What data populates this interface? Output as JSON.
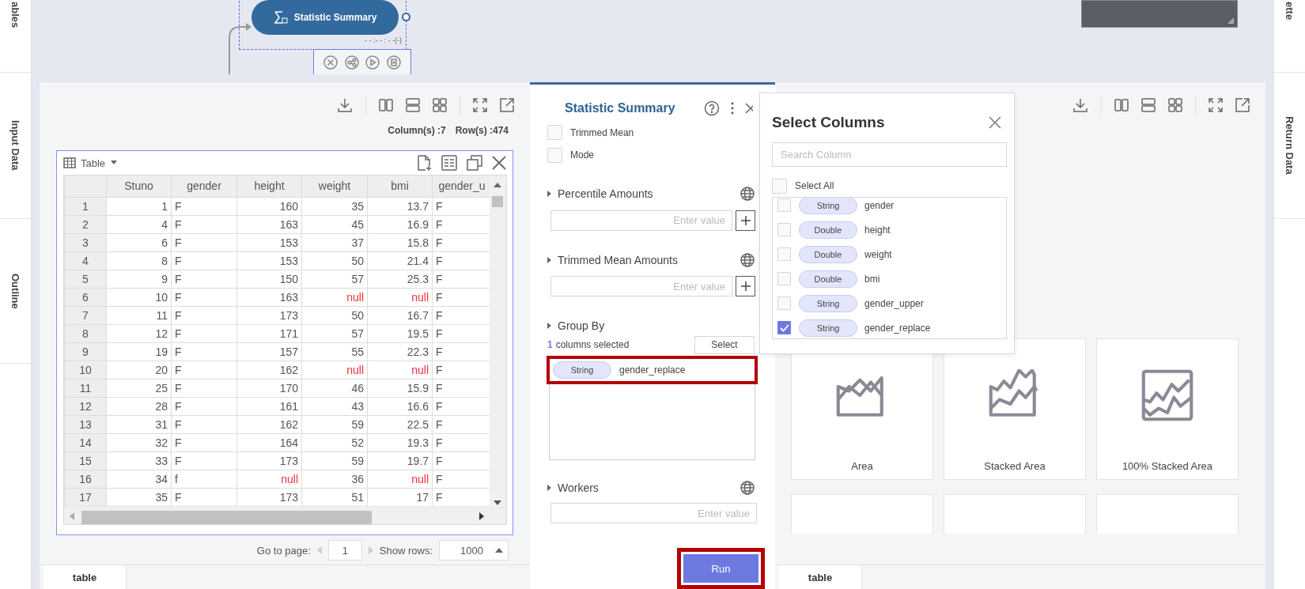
{
  "left_rail": [
    {
      "label": "ables"
    },
    {
      "label": "Input Data"
    },
    {
      "label": "Outline"
    }
  ],
  "right_rail": [
    {
      "label": "ette"
    },
    {
      "label": "Return Data"
    }
  ],
  "canvas": {
    "node": {
      "label": "Statistic Summary",
      "status": "- - :- - : - -(-)"
    }
  },
  "data_panel": {
    "column_count": "Column(s) :7",
    "row_count": "Row(s) :474",
    "table": {
      "view": "Table",
      "columns": [
        "Stuno",
        "gender",
        "height",
        "weight",
        "bmi",
        "gender_u"
      ],
      "rows": [
        {
          "index": "1",
          "cells": [
            "1",
            "F",
            "160",
            "35",
            "13.7",
            "F"
          ]
        },
        {
          "index": "2",
          "cells": [
            "4",
            "F",
            "163",
            "45",
            "16.9",
            "F"
          ]
        },
        {
          "index": "3",
          "cells": [
            "6",
            "F",
            "153",
            "37",
            "15.8",
            "F"
          ]
        },
        {
          "index": "4",
          "cells": [
            "8",
            "F",
            "153",
            "50",
            "21.4",
            "F"
          ]
        },
        {
          "index": "5",
          "cells": [
            "9",
            "F",
            "150",
            "57",
            "25.3",
            "F"
          ]
        },
        {
          "index": "6",
          "cells": [
            "10",
            "F",
            "163",
            {
              "text": "null",
              "missing": true
            },
            {
              "text": "null",
              "missing": true
            },
            "F"
          ]
        },
        {
          "index": "7",
          "cells": [
            "11",
            "F",
            "173",
            "50",
            "16.7",
            "F"
          ]
        },
        {
          "index": "8",
          "cells": [
            "12",
            "F",
            "171",
            "57",
            "19.5",
            "F"
          ]
        },
        {
          "index": "9",
          "cells": [
            "19",
            "F",
            "157",
            "55",
            "22.3",
            "F"
          ]
        },
        {
          "index": "10",
          "cells": [
            "20",
            "F",
            "162",
            {
              "text": "null",
              "missing": true
            },
            {
              "text": "null",
              "missing": true
            },
            "F"
          ]
        },
        {
          "index": "11",
          "cells": [
            "25",
            "F",
            "170",
            "46",
            "15.9",
            "F"
          ]
        },
        {
          "index": "12",
          "cells": [
            "28",
            "F",
            "161",
            "43",
            "16.6",
            "F"
          ]
        },
        {
          "index": "13",
          "cells": [
            "31",
            "F",
            "162",
            "59",
            "22.5",
            "F"
          ]
        },
        {
          "index": "14",
          "cells": [
            "32",
            "F",
            "164",
            "52",
            "19.3",
            "F"
          ]
        },
        {
          "index": "15",
          "cells": [
            "33",
            "F",
            "173",
            "59",
            "19.7",
            "F"
          ]
        },
        {
          "index": "16",
          "cells": [
            "34",
            "f",
            {
              "text": "null",
              "missing": true
            },
            "36",
            {
              "text": "null",
              "missing": true
            },
            "F"
          ]
        },
        {
          "index": "17",
          "cells": [
            "35",
            "F",
            "173",
            "51",
            "17",
            "F"
          ]
        }
      ]
    },
    "pagination": {
      "page_label": "Go to page:",
      "page": "1",
      "rows_label": "Show rows:",
      "rows": "1000"
    },
    "tabs": [
      {
        "label": "table",
        "selected": true
      }
    ]
  },
  "settings_panel": {
    "title": "Statistic Summary",
    "options": [
      {
        "label": "Trimmed Mean",
        "checked": false
      },
      {
        "label": "Mode",
        "checked": false
      }
    ],
    "sections": [
      {
        "kind": "input_add",
        "label": "Percentile Amounts",
        "placeholder": "Enter value"
      },
      {
        "kind": "input_add",
        "label": "Trimmed Mean Amounts",
        "placeholder": "Enter value"
      },
      {
        "kind": "group",
        "label": "Group By",
        "count": "1",
        "count_label": "columns selected",
        "button": "Select",
        "highlighted": true,
        "chips": [
          {
            "type": "String",
            "name": "gender_replace"
          }
        ]
      },
      {
        "kind": "input_global",
        "label": "Workers",
        "placeholder": "Enter value"
      }
    ],
    "run": {
      "label": "Run",
      "highlighted": true
    }
  },
  "column_picker": {
    "title": "Select Columns",
    "placeholder": "Search Column",
    "select_all": {
      "label": "Select All",
      "checked": false
    },
    "items": [
      {
        "type": "String",
        "name": "gender",
        "checked": false
      },
      {
        "type": "Double",
        "name": "height",
        "checked": false
      },
      {
        "type": "Double",
        "name": "weight",
        "checked": false
      },
      {
        "type": "Double",
        "name": "bmi",
        "checked": false
      },
      {
        "type": "String",
        "name": "gender_upper",
        "checked": false
      },
      {
        "type": "String",
        "name": "gender_replace",
        "checked": true
      }
    ]
  },
  "chart_panel": {
    "charts": [
      {
        "kind": "area",
        "label": "Area"
      },
      {
        "kind": "stacked",
        "label": "Stacked Area"
      },
      {
        "kind": "percent",
        "label": "100% Stacked Area"
      },
      {
        "kind": "blank"
      },
      {
        "kind": "blank"
      },
      {
        "kind": "blank"
      }
    ],
    "tabs": [
      {
        "label": "table",
        "selected": true
      }
    ]
  }
}
